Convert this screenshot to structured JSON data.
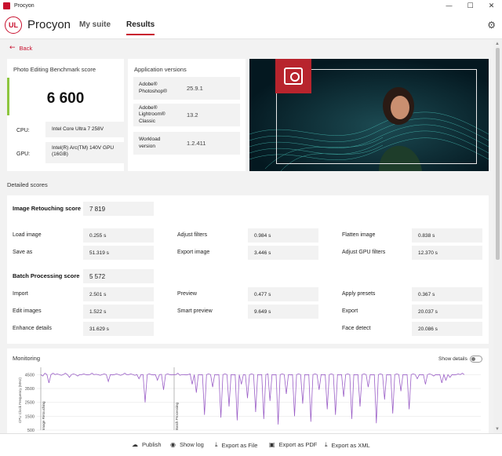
{
  "window": {
    "title": "Procyon",
    "minimize": "—",
    "maximize": "☐",
    "close": "✕"
  },
  "header": {
    "logo_text": "UL",
    "app_name": "Procyon",
    "nav": [
      "My suite",
      "Results"
    ],
    "active_nav": "Results",
    "settings_icon": "gear-icon"
  },
  "back_label": "Back",
  "score_card": {
    "title": "Photo Editing Benchmark score",
    "score": "6 600",
    "cpu_label": "CPU:",
    "cpu_value": "Intel Core Ultra 7 258V",
    "gpu_label": "GPU:",
    "gpu_value": "Intel(R) Arc(TM) 140V GPU (16GB)"
  },
  "versions_card": {
    "title": "Application versions",
    "items": [
      {
        "name": "Adobe® Photoshop®",
        "version": "25.9.1"
      },
      {
        "name": "Adobe® Lightroom® Classic",
        "version": "13.2"
      },
      {
        "name": "Workload version",
        "version": "1.2.411"
      }
    ]
  },
  "detailed": {
    "title": "Detailed scores",
    "retouching": {
      "label": "Image Retouching score",
      "score": "7 819",
      "items": [
        {
          "label": "Load image",
          "value": "0.255 s"
        },
        {
          "label": "Adjust filters",
          "value": "0.984 s"
        },
        {
          "label": "Flatten image",
          "value": "0.838 s"
        },
        {
          "label": "Save as",
          "value": "51.319 s"
        },
        {
          "label": "Export image",
          "value": "3.446 s"
        },
        {
          "label": "Adjust GPU filters",
          "value": "12.370 s"
        }
      ]
    },
    "batch": {
      "label": "Batch Processing score",
      "score": "5 572",
      "items": [
        {
          "label": "Import",
          "value": "2.501 s"
        },
        {
          "label": "Preview",
          "value": "0.477 s"
        },
        {
          "label": "Apply presets",
          "value": "0.367 s"
        },
        {
          "label": "Edit images",
          "value": "1.522 s"
        },
        {
          "label": "Smart preview",
          "value": "9.649 s"
        },
        {
          "label": "Export",
          "value": "20.037 s"
        },
        {
          "label": "Enhance details",
          "value": "31.629 s"
        },
        {
          "label": "Face detect",
          "value": "20.086 s"
        }
      ]
    }
  },
  "monitoring": {
    "title": "Monitoring",
    "toggle_label": "Show details",
    "toggle_on": false,
    "y_axis_label": "CPU Clock Frequency (MHz)",
    "markers": [
      "Image Retouching",
      "Batch Processing"
    ],
    "colors": {
      "line": "#9b5fc7",
      "accent": "#c8102e"
    }
  },
  "chart_data": {
    "type": "line",
    "title": "",
    "ylabel": "CPU Clock Frequency (MHz)",
    "yticks": [
      "4500",
      "3500",
      "2500",
      "1500",
      "500"
    ],
    "ylim": [
      500,
      4800
    ],
    "series": [
      {
        "values": [
          4500,
          4400,
          4600,
          4500,
          3900,
          4500,
          4600,
          4500,
          4550,
          4500,
          4450,
          4500,
          4600,
          4500,
          4300,
          4500,
          4550,
          4500,
          4400,
          4500,
          4500,
          4550,
          4500,
          4480,
          4500,
          4600,
          4500,
          4520,
          4500,
          4450,
          4500,
          4550,
          4500,
          4000,
          4500,
          4480,
          4500,
          4550,
          4500,
          4450,
          4500,
          4600,
          4500,
          4500,
          4550,
          4500,
          4450,
          4500,
          4200,
          4500,
          4500,
          2500,
          4500,
          4550,
          4500,
          4480,
          4500,
          4100,
          4500,
          4520,
          3400,
          4500,
          4550,
          4500,
          4480,
          4500,
          4500,
          4600,
          4450,
          4500,
          4500,
          4480,
          4500,
          4550,
          3800,
          4500,
          3200,
          4500,
          4480,
          4500,
          1600,
          4500,
          4550,
          4500,
          3600,
          4500,
          4480,
          4500,
          1400,
          4500,
          4550,
          4500,
          2200,
          4500,
          4480,
          4500,
          1200,
          4500,
          3800,
          4500,
          4480,
          2800,
          4500,
          4550,
          4500,
          1800,
          4500,
          4480,
          4500,
          1300,
          4500,
          4550,
          2600,
          4500,
          4480,
          4500,
          900,
          4500,
          4550,
          4500,
          3100,
          4500,
          4480,
          4500,
          1500,
          4500,
          4550,
          4500,
          2400,
          4500,
          4480,
          4500,
          1100,
          4500,
          4550,
          4500,
          3400,
          4500,
          4480,
          4500,
          2000,
          4500,
          4550,
          4500,
          1600,
          4500,
          4480,
          4500,
          2900,
          4500,
          4550,
          4500,
          1300,
          4500,
          4480,
          4500,
          2200,
          4500,
          4550,
          4500,
          3600,
          4500,
          4480,
          4500,
          1000,
          4500,
          4550,
          4500,
          2700,
          4500,
          4480,
          4500,
          1700,
          4500,
          4550,
          4500,
          3300,
          4500,
          4480,
          4500,
          2000,
          4500,
          4550,
          4500,
          4200,
          4500,
          4480,
          4500,
          3800,
          4500,
          4550,
          4500,
          4400,
          4500,
          4480,
          4500,
          3900,
          4500,
          4100,
          4500,
          4300,
          4500,
          4480,
          4500,
          4550,
          4500,
          4600,
          4500
        ]
      }
    ],
    "grid": true
  },
  "footer": [
    {
      "icon": "publish-icon",
      "glyph": "☁",
      "label": "Publish"
    },
    {
      "icon": "log-icon",
      "glyph": "👁",
      "label": "Show log"
    },
    {
      "icon": "download-icon",
      "glyph": "⤓",
      "label": "Export as File"
    },
    {
      "icon": "save-icon",
      "glyph": "🖫",
      "label": "Export as PDF"
    },
    {
      "icon": "download-icon",
      "glyph": "⤓",
      "label": "Export as XML"
    }
  ]
}
